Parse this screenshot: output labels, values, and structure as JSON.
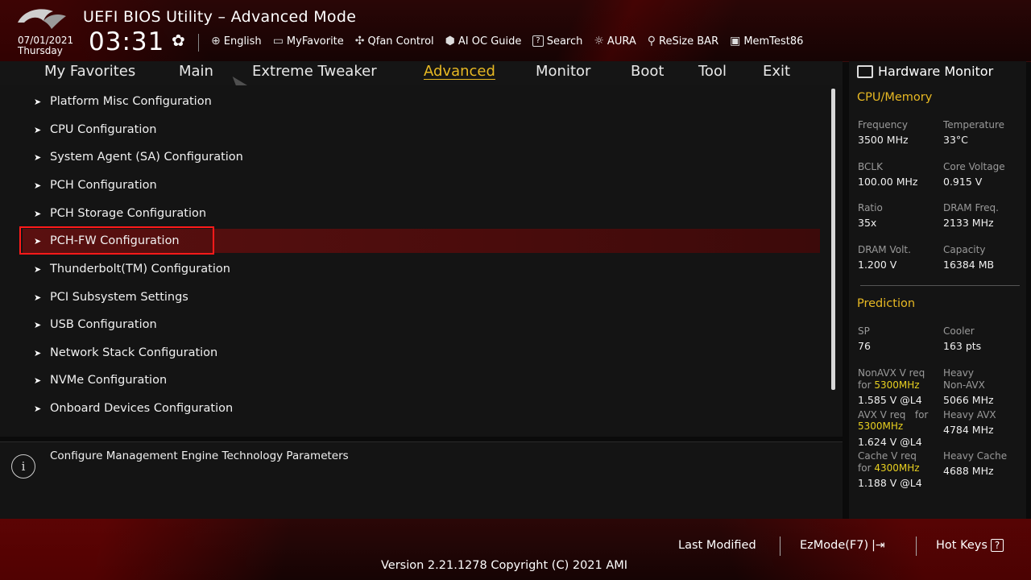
{
  "header": {
    "title": "UEFI BIOS Utility – Advanced Mode",
    "date": "07/01/2021",
    "day": "Thursday",
    "time": "03:31",
    "toolbar": [
      {
        "label": "English",
        "icon": "globe-icon"
      },
      {
        "label": "MyFavorite",
        "icon": "favorite-icon"
      },
      {
        "label": "Qfan Control",
        "icon": "fan-icon"
      },
      {
        "label": "AI OC Guide",
        "icon": "ai-icon"
      },
      {
        "label": "Search",
        "icon": "search-icon"
      },
      {
        "label": "AURA",
        "icon": "aura-icon"
      },
      {
        "label": "ReSize BAR",
        "icon": "resize-bar-icon"
      },
      {
        "label": "MemTest86",
        "icon": "memtest-icon"
      }
    ]
  },
  "tabs": [
    "My Favorites",
    "Main",
    "Extreme Tweaker",
    "Advanced",
    "Monitor",
    "Boot",
    "Tool",
    "Exit"
  ],
  "active_tab": "Advanced",
  "menu": [
    "Platform Misc Configuration",
    "CPU Configuration",
    "System Agent (SA) Configuration",
    "PCH Configuration",
    "PCH Storage Configuration",
    "PCH-FW Configuration",
    "Thunderbolt(TM) Configuration",
    "PCI Subsystem Settings",
    "USB Configuration",
    "Network Stack Configuration",
    "NVMe Configuration",
    "Onboard Devices Configuration"
  ],
  "selected_menu": "PCH-FW Configuration",
  "help": "Configure Management Engine Technology Parameters",
  "hw": {
    "title": "Hardware Monitor",
    "cpu_memory": "CPU/Memory",
    "frequency_label": "Frequency",
    "frequency": "3500 MHz",
    "temperature_label": "Temperature",
    "temperature": "33°C",
    "bclk_label": "BCLK",
    "bclk": "100.00 MHz",
    "core_voltage_label": "Core Voltage",
    "core_voltage": "0.915 V",
    "ratio_label": "Ratio",
    "ratio": "35x",
    "dram_freq_label": "DRAM Freq.",
    "dram_freq": "2133 MHz",
    "dram_volt_label": "DRAM Volt.",
    "dram_volt": "1.200 V",
    "capacity_label": "Capacity",
    "capacity": "16384 MB",
    "prediction": "Prediction",
    "sp_label": "SP",
    "sp": "76",
    "cooler_label": "Cooler",
    "cooler": "163 pts",
    "nonavx_label": "NonAVX V req",
    "nonavx_for": "for",
    "nonavx_freq": "5300MHz",
    "nonavx_val": "1.585 V @L4",
    "heavy_nonavx_label1": "Heavy",
    "heavy_nonavx_label2": "Non-AVX",
    "heavy_nonavx": "5066 MHz",
    "avx_label": "AVX V req",
    "avx_for": "for",
    "avx_freq": "5300MHz",
    "avx_val": "1.624 V @L4",
    "heavy_avx_label": "Heavy AVX",
    "heavy_avx": "4784 MHz",
    "cache_label": "Cache V req",
    "cache_for": "for",
    "cache_freq": "4300MHz",
    "cache_val": "1.188 V @L4",
    "heavy_cache_label": "Heavy Cache",
    "heavy_cache": "4688 MHz"
  },
  "footer": {
    "last_modified": "Last Modified",
    "ezmode": "EzMode(F7)",
    "hotkeys": "Hot Keys",
    "hotkeys_key": "?",
    "version": "Version 2.21.1278 Copyright (C) 2021 AMI"
  }
}
